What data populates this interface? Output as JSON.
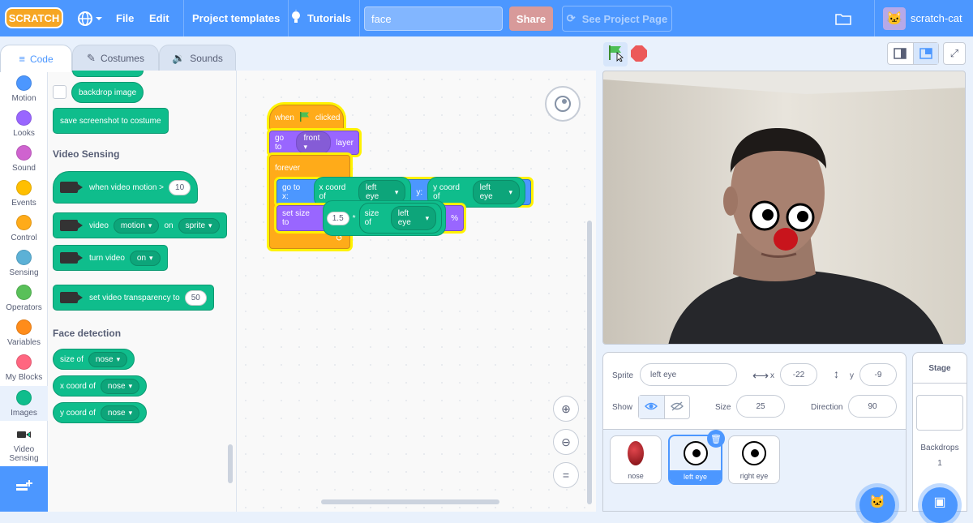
{
  "menu": {
    "logo": "SCRATCH",
    "file": "File",
    "edit": "Edit",
    "templates": "Project templates",
    "tutorials": "Tutorials",
    "project_title": "face",
    "share": "Share",
    "see_project_page": "See Project Page",
    "username": "scratch-cat"
  },
  "tabs": [
    {
      "label": "Code",
      "icon": "code-icon"
    },
    {
      "label": "Costumes",
      "icon": "brush-icon"
    },
    {
      "label": "Sounds",
      "icon": "speaker-icon"
    }
  ],
  "categories": [
    {
      "label": "Motion",
      "color": "#4c97ff"
    },
    {
      "label": "Looks",
      "color": "#9966ff"
    },
    {
      "label": "Sound",
      "color": "#cf63cf"
    },
    {
      "label": "Events",
      "color": "#ffbf00"
    },
    {
      "label": "Control",
      "color": "#ffab19"
    },
    {
      "label": "Sensing",
      "color": "#5cb1d6"
    },
    {
      "label": "Operators",
      "color": "#59c059"
    },
    {
      "label": "Variables",
      "color": "#ff8c1a"
    },
    {
      "label": "My Blocks",
      "color": "#ff6680"
    },
    {
      "label": "Images",
      "color": "#0fbd8c"
    },
    {
      "label": "Video Sensing",
      "color": "#0fbd8c"
    }
  ],
  "palette": {
    "backdrop_image": "backdrop image",
    "save_screenshot": "save screenshot to costume",
    "video_sensing_heading": "Video Sensing",
    "when_video_motion": "when video motion >",
    "when_video_motion_value": "10",
    "video_word": "video",
    "video_motion_dropdown": "motion",
    "on_word": "on",
    "video_sprite_dropdown": "sprite",
    "turn_video": "turn video",
    "turn_video_dropdown": "on",
    "set_transparency": "set video transparency to",
    "set_transparency_value": "50",
    "face_detection_heading": "Face detection",
    "size_of": "size of",
    "x_coord_of": "x coord of",
    "y_coord_of": "y coord of",
    "nose_dropdown": "nose"
  },
  "script": {
    "when_flag": "when",
    "clicked": "clicked",
    "go_to": "go to",
    "front": "front",
    "layer": "layer",
    "forever": "forever",
    "go_to_x": "go to x:",
    "x_coord_of": "x coord of",
    "left_eye": "left eye",
    "y_label": "y:",
    "y_coord_of": "y coord of",
    "set_size_to": "set size to",
    "multiplier": "1.5",
    "times": "*",
    "size_of": "size of",
    "percent": "%"
  },
  "sprite_info": {
    "sprite_label": "Sprite",
    "sprite_name": "left eye",
    "x_label": "x",
    "x_value": "-22",
    "y_label": "y",
    "y_value": "-9",
    "show_label": "Show",
    "size_label": "Size",
    "size_value": "25",
    "direction_label": "Direction",
    "direction_value": "90"
  },
  "sprites": [
    {
      "name": "nose"
    },
    {
      "name": "left eye"
    },
    {
      "name": "right eye"
    }
  ],
  "stage_panel": {
    "title": "Stage",
    "backdrops_label": "Backdrops",
    "backdrops_count": "1"
  }
}
